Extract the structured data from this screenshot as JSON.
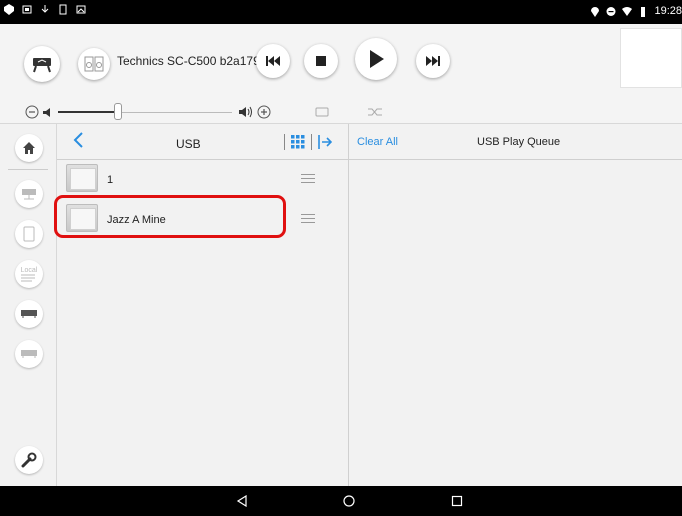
{
  "status_bar": {
    "time": "19:28"
  },
  "player": {
    "device_name": "Technics SC-C500 b2a179"
  },
  "browser": {
    "title": "USB",
    "items": [
      {
        "label": "1"
      },
      {
        "label": "Jazz A Mine"
      }
    ]
  },
  "queue": {
    "clear_all_label": "Clear All",
    "title": "USB Play Queue"
  },
  "nav_buttons": {
    "local_label": "Local"
  },
  "colors": {
    "accent": "#2a8ee0",
    "highlight": "#e01010"
  }
}
